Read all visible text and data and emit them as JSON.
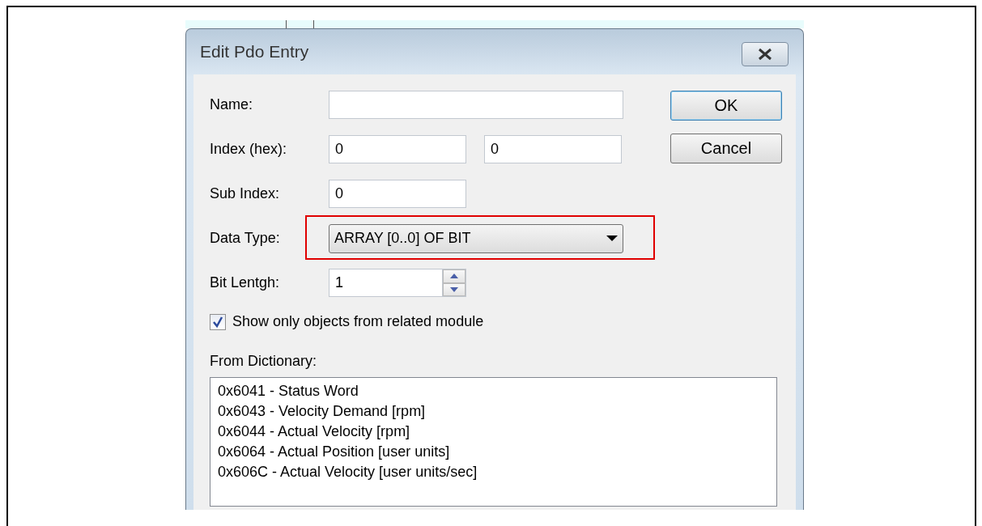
{
  "window": {
    "title": "Edit Pdo Entry"
  },
  "fields": [
    {
      "kind": "wide_text",
      "label": "Name:"
    },
    {
      "kind": "text",
      "label": "Index (hex):",
      "values": [
        "0",
        "0"
      ]
    },
    {
      "kind": "text",
      "label": "Sub Index:",
      "values": [
        "0"
      ]
    },
    {
      "kind": "combo",
      "label": "Data Type:",
      "values": [
        "ARRAY [0..0] OF BIT"
      ],
      "highlighted": true
    },
    {
      "kind": "spin",
      "label": "Bit Lentgh:",
      "values": [
        "1"
      ]
    }
  ],
  "checkbox": {
    "label": "Show only objects from related module",
    "checked": true
  },
  "dictionary": {
    "label": "From Dictionary:",
    "items": [
      {
        "text": "0x6041 - Status Word",
        "selected": false
      },
      {
        "text": "0x6043 - Velocity Demand [rpm]",
        "selected": false
      },
      {
        "text": "0x6044 - Actual Velocity [rpm]",
        "selected": false
      },
      {
        "text": "0x6064 - Actual Position [user units]",
        "selected": false
      },
      {
        "text": "0x606C - Actual Velocity [user units/sec]",
        "selected": false
      }
    ]
  },
  "buttons": [
    "OK",
    "Cancel"
  ]
}
